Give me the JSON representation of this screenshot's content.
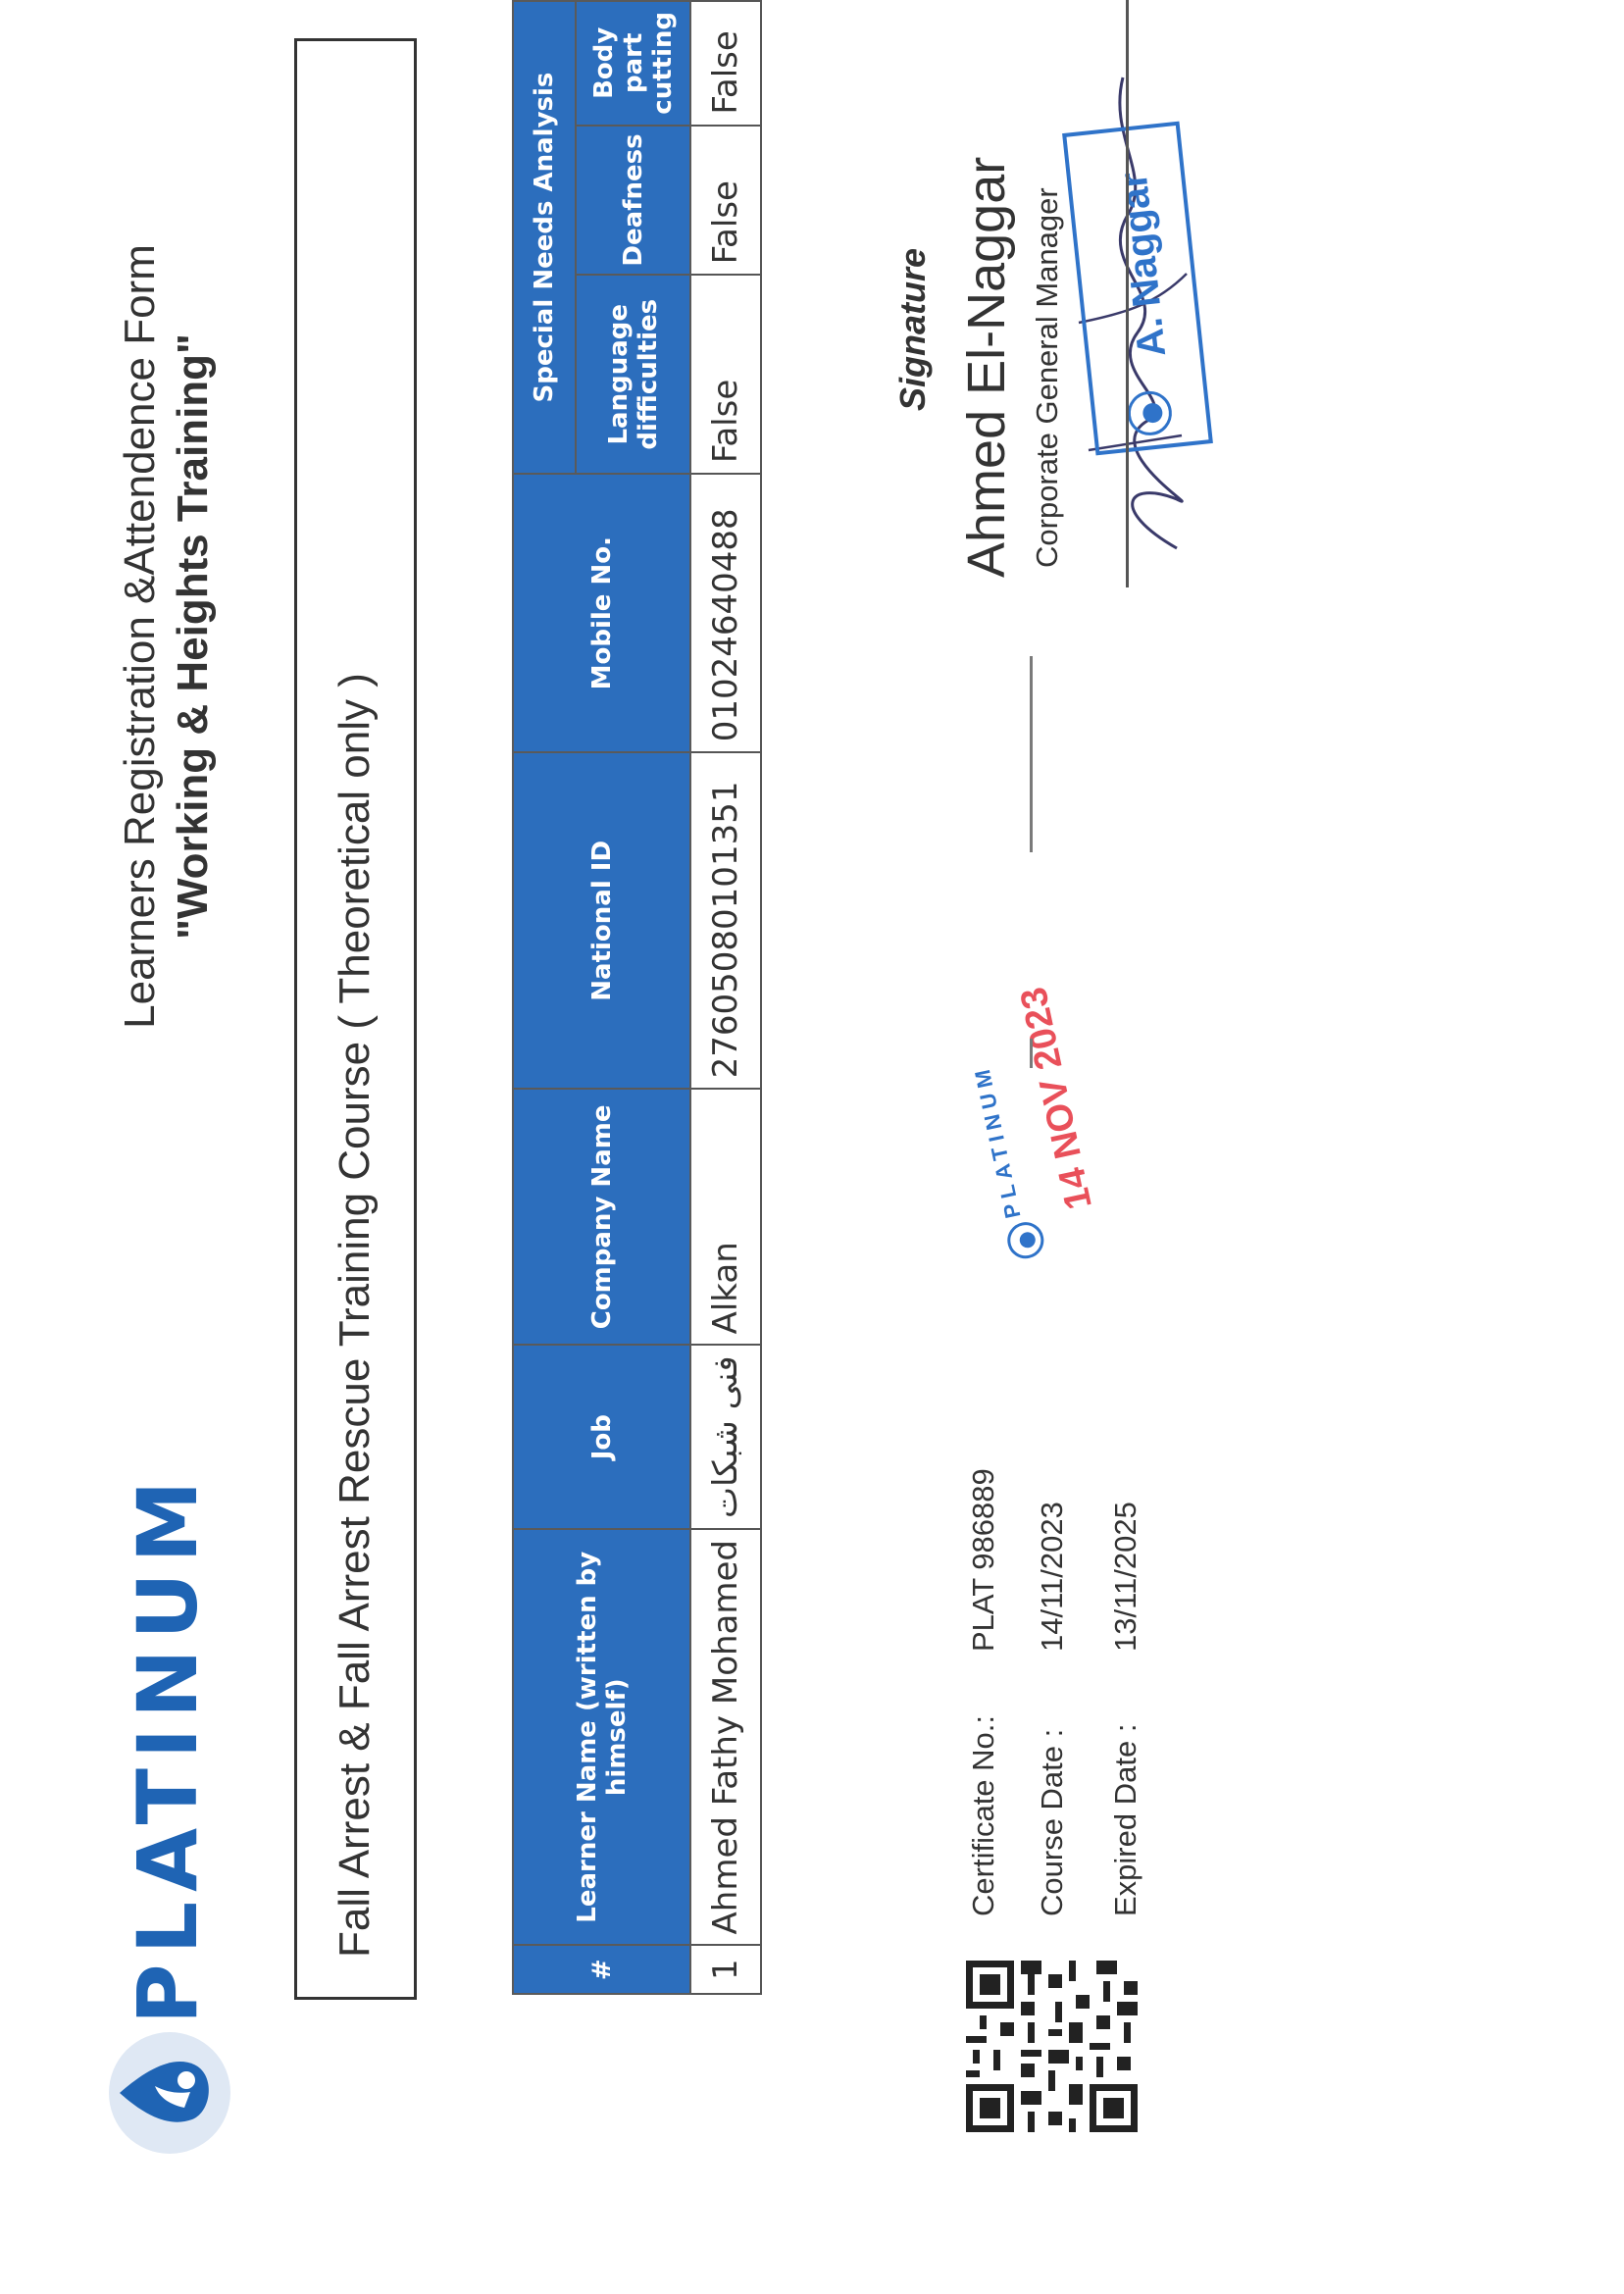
{
  "brand": {
    "name": "PLATINUM",
    "color": "#1f64b4"
  },
  "header": {
    "title": "Learners Registration &Attendence Form",
    "subtitle": "\"Working & Heights Training\""
  },
  "course": {
    "title": "Fall Arrest & Fall Arrest Rescue Training Course ( Theoretical only )"
  },
  "table": {
    "group_header": "Special Needs Analysis",
    "columns": [
      "#",
      "Learner Name (written by himself)",
      "Job",
      "Company Name",
      "National ID",
      "Mobile No.",
      "Language difficulties",
      "Deafness",
      "Body part cutting"
    ],
    "rows": [
      {
        "num": "1",
        "name": "Ahmed Fathy Mohamed",
        "job": "فنى شبكات",
        "company": "Alkan",
        "national_id": "27605080101351",
        "mobile": "01024640488",
        "language": "False",
        "deafness": "False",
        "body_part": "False"
      }
    ],
    "header_color": "#2c6ebd"
  },
  "certificate": {
    "cert_label": "Certificate No.:",
    "cert_value": "PLAT 986889",
    "course_date_label": "Course Date :",
    "course_date_value": "14/11/2023",
    "expired_label": "Expired Date :",
    "expired_value": "13/11/2025"
  },
  "stamp": {
    "brand": "PLATINUM",
    "date": "14 NOV 2023",
    "color": "#e9505a"
  },
  "signature": {
    "label": "Signature",
    "name": "Ahmed El-Naggar",
    "title": "Corporate General Manager",
    "stamp_text": "A. Naggar",
    "stamp_color": "#2f73c9"
  }
}
